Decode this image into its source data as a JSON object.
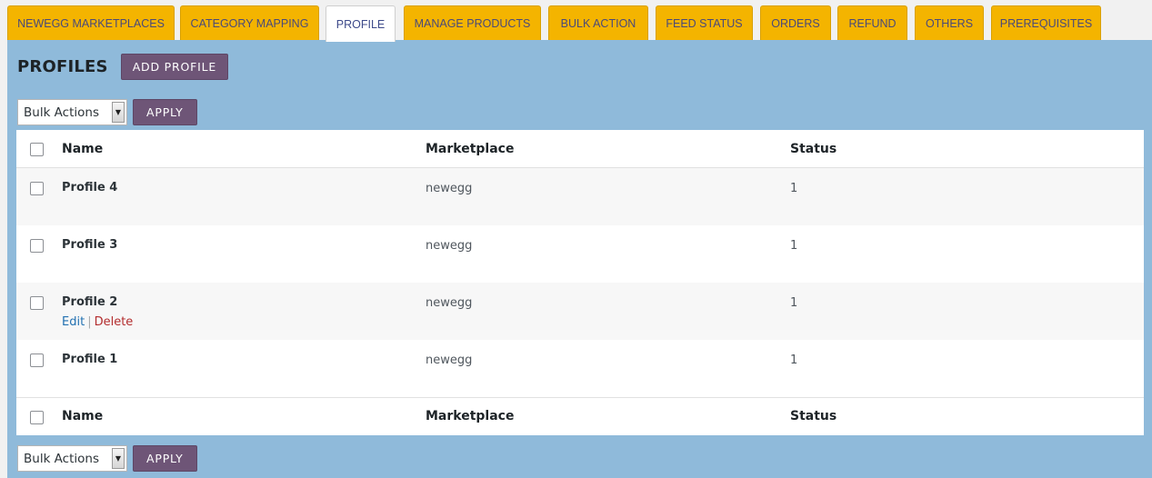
{
  "tabs": [
    {
      "label": "NEWEGG MARKETPLACES"
    },
    {
      "label": "CATEGORY MAPPING"
    },
    {
      "label": "PROFILE"
    },
    {
      "label": "MANAGE PRODUCTS"
    },
    {
      "label": "BULK ACTION"
    },
    {
      "label": "FEED STATUS"
    },
    {
      "label": "ORDERS"
    },
    {
      "label": "REFUND"
    },
    {
      "label": "OTHERS"
    },
    {
      "label": "PREREQUISITES"
    }
  ],
  "active_tab": "PROFILE",
  "header": {
    "title": "PROFILES",
    "add_button": "ADD PROFILE"
  },
  "bulk": {
    "select_value": "Bulk Actions",
    "apply_label": "APPLY"
  },
  "table": {
    "columns": [
      "Name",
      "Marketplace",
      "Status"
    ],
    "rows": [
      {
        "name": "Profile 4",
        "marketplace": "newegg",
        "status": "1"
      },
      {
        "name": "Profile 3",
        "marketplace": "newegg",
        "status": "1"
      },
      {
        "name": "Profile 2",
        "marketplace": "newegg",
        "status": "1"
      },
      {
        "name": "Profile 1",
        "marketplace": "newegg",
        "status": "1"
      }
    ],
    "row_actions": {
      "edit": "Edit",
      "separator": "|",
      "delete": "Delete"
    }
  },
  "colors": {
    "tab": "#f4b400",
    "panel": "#8fbada",
    "button": "#6e5577"
  }
}
